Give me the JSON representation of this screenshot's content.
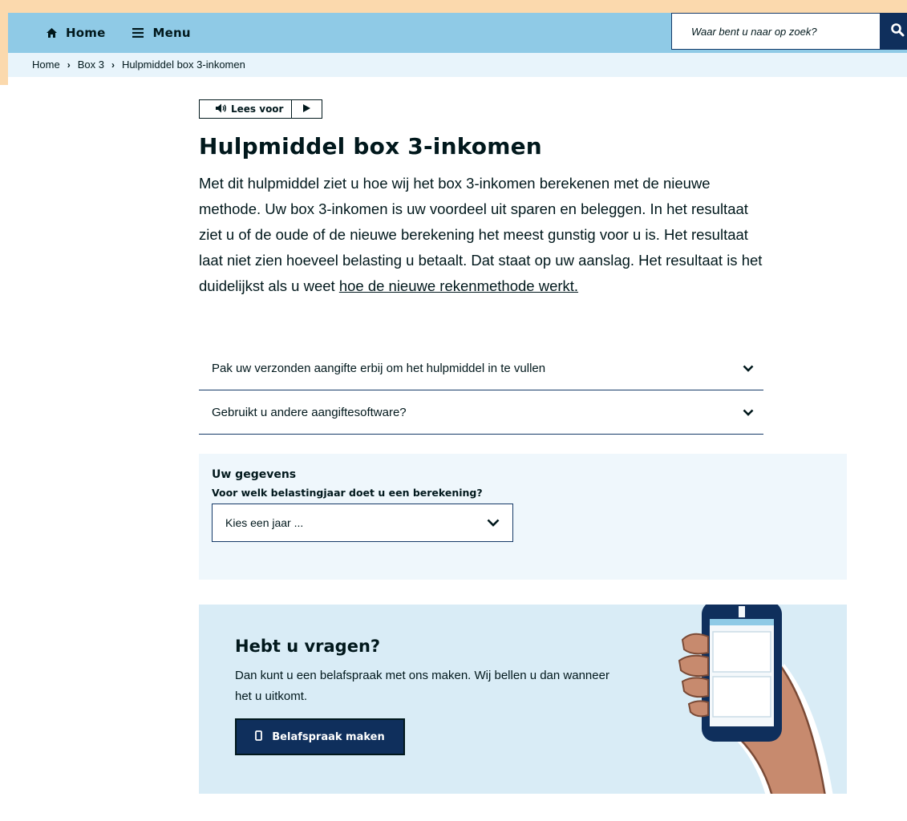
{
  "header": {
    "home_label": "Home",
    "menu_label": "Menu",
    "search_placeholder": "Waar bent u naar op zoek?"
  },
  "breadcrumb": {
    "items": [
      "Home",
      "Box 3",
      "Hulpmiddel box 3-inkomen"
    ],
    "separator": "›"
  },
  "read_aloud": {
    "label": "Lees voor"
  },
  "page": {
    "title": "Hulpmiddel box 3-inkomen",
    "intro_text": "Met dit hulpmiddel ziet u hoe wij het box 3-inkomen berekenen met de nieuwe methode. Uw box 3-inkomen is uw voordeel uit sparen en beleggen. In het resultaat ziet u of de oude of de nieuwe berekening het meest gunstig voor u is. Het resultaat laat niet zien hoeveel belasting u betaalt. Dat staat op uw aanslag. Het resultaat is het duidelijkst als u weet ",
    "intro_link": "hoe de nieuwe rekenmethode werkt."
  },
  "accordion": {
    "items": [
      "Pak uw verzonden aangifte erbij om het hulpmiddel in te vullen",
      "Gebruikt u andere aangiftesoftware?"
    ]
  },
  "gegevens": {
    "title": "Uw gegevens",
    "question": "Voor welk belastingjaar doet u een berekening?",
    "select_value": "Kies een jaar ..."
  },
  "vragen": {
    "title": "Hebt u vragen?",
    "text": "Dan kunt u een belafspraak met ons maken. Wij bellen u dan wanneer het u uitkomt.",
    "button_label": "Belafspraak maken"
  },
  "colors": {
    "header_bg": "#8fcae6",
    "brand_dark": "#0f2f5c",
    "text": "#01181c",
    "panel_light": "#eff7fc",
    "panel_blue": "#d9ecf6",
    "frame": "#fbd9ad",
    "skin": "#c78a6e"
  },
  "icons": {
    "home": "home-icon",
    "menu": "hamburger-icon",
    "search": "search-icon",
    "speaker": "speaker-icon",
    "play": "play-icon",
    "chevron": "chevron-down-icon",
    "phone": "phone-icon"
  }
}
